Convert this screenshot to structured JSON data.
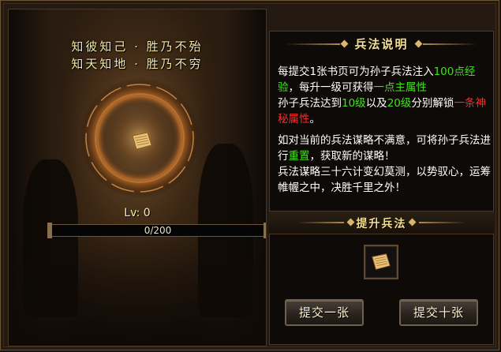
{
  "art": {
    "poem_line1": "知彼知己 · 胜乃不殆",
    "poem_line2": "知天知地 · 胜乃不穷",
    "level_label": "Lv: 0",
    "progress_text": "0/200",
    "progress_fraction": 0.0
  },
  "info": {
    "header_title": "兵法说明",
    "para1": {
      "a": "每提交1张书页可为孙子兵法注入",
      "b": "100点经验",
      "c": "，每升一级可获得",
      "d": "一点主属性"
    },
    "para2": {
      "a": "孙子兵法达到",
      "b": "10级",
      "c": "以及",
      "d": "20级",
      "e": "分别解锁",
      "f": "一条神秘属性",
      "g": "。"
    },
    "para3": {
      "a": "如对当前的兵法谋略不满意，可将孙子兵法进行",
      "b": "重置",
      "c": "，获取新的谋略！"
    },
    "para4": "兵法谋略三十六计变幻莫测，以势驭心，运筹帷幄之中，决胜千里之外！"
  },
  "upgrade": {
    "header_title": "提升兵法",
    "submit_one_label": "提交一张",
    "submit_ten_label": "提交十张",
    "item_icon": "scroll-page-icon"
  },
  "colors": {
    "highlight_green": "#41e01f",
    "highlight_red": "#ff2a2a",
    "gold_title": "#f3dd95"
  }
}
